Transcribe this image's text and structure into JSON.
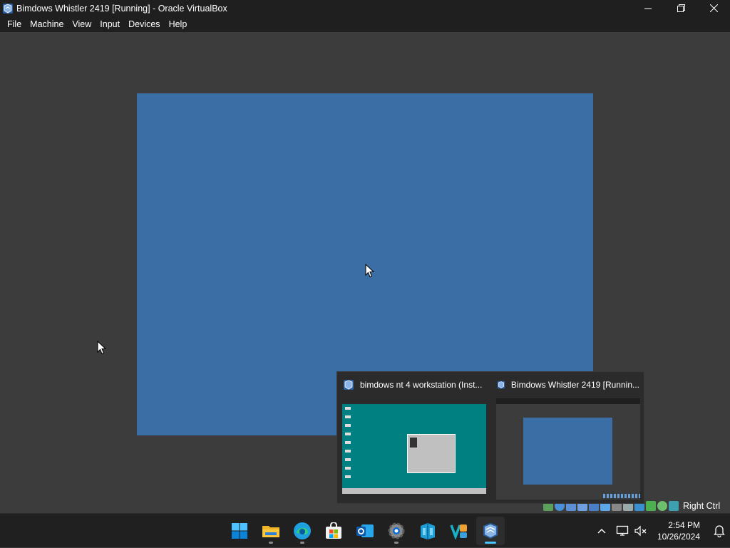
{
  "window": {
    "title": "Bimdows Whistler 2419 [Running] - Oracle VirtualBox",
    "icon": "virtualbox-icon"
  },
  "menu": {
    "items": [
      {
        "label": "File"
      },
      {
        "label": "Machine"
      },
      {
        "label": "View"
      },
      {
        "label": "Input"
      },
      {
        "label": "Devices"
      },
      {
        "label": "Help"
      }
    ]
  },
  "vm": {
    "screen_color": "#3a6ea5"
  },
  "statusbar": {
    "host_key": "Right Ctrl",
    "indicators": [
      "hard-disk-icon",
      "optical-drive-icon",
      "audio-icon",
      "network-icon",
      "usb-icon",
      "shared-folders-icon",
      "display-icon",
      "recording-icon",
      "cpu-icon",
      "guest-additions-icon",
      "mouse-integration-icon",
      "keyboard-icon"
    ]
  },
  "taskbar_previews": [
    {
      "title": "bimdows nt 4 workstation (Inst..."
    },
    {
      "title": "Bimdows Whistler 2419 [Runnin..."
    }
  ],
  "taskbar": {
    "apps": [
      {
        "name": "start-icon"
      },
      {
        "name": "file-explorer-icon"
      },
      {
        "name": "edge-icon"
      },
      {
        "name": "microsoft-store-icon"
      },
      {
        "name": "outlook-icon"
      },
      {
        "name": "settings-icon"
      },
      {
        "name": "azure-data-studio-icon"
      },
      {
        "name": "vs-code-like-icon"
      },
      {
        "name": "virtualbox-icon"
      }
    ],
    "clock": {
      "time": "2:54 PM",
      "date": "10/26/2024"
    }
  }
}
